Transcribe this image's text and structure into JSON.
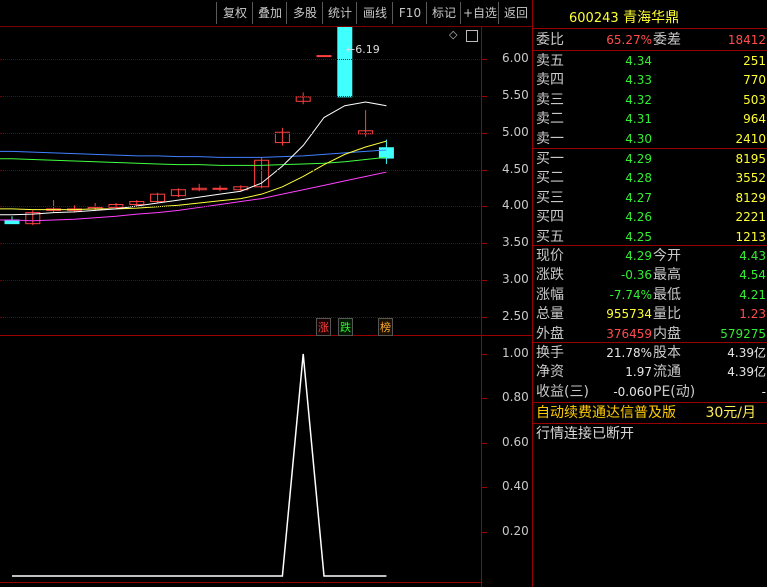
{
  "toolbar": {
    "buttons": [
      "复权",
      "叠加",
      "多股",
      "统计",
      "画线",
      "F10",
      "标记",
      "+自选",
      "返回"
    ]
  },
  "chart": {
    "price_ticks": [
      "6.00",
      "5.50",
      "5.00",
      "4.50",
      "4.00",
      "3.50",
      "3.00",
      "2.50"
    ],
    "price_axis": {
      "min": 2.5,
      "max": 6.0
    },
    "max_label": "6.19",
    "tags": [
      "涨",
      "跌",
      "榜"
    ],
    "indicator_ticks": [
      "1.00",
      "0.80",
      "0.60",
      "0.40",
      "0.20"
    ],
    "colors": {
      "up": "#ff4040",
      "down": "#40ffff",
      "ma5": "#ffffff",
      "ma10": "#ffff40",
      "ma20": "#ff40ff",
      "ma30": "#40ff40",
      "ma60": "#4080ff"
    },
    "candles": [
      {
        "o": 3.45,
        "h": 3.5,
        "l": 3.42,
        "c": 3.4
      },
      {
        "o": 3.4,
        "h": 3.58,
        "l": 3.38,
        "c": 3.55
      },
      {
        "o": 3.58,
        "h": 3.72,
        "l": 3.55,
        "c": 3.6
      },
      {
        "o": 3.58,
        "h": 3.65,
        "l": 3.55,
        "c": 3.6
      },
      {
        "o": 3.6,
        "h": 3.68,
        "l": 3.58,
        "c": 3.62
      },
      {
        "o": 3.62,
        "h": 3.68,
        "l": 3.6,
        "c": 3.66
      },
      {
        "o": 3.66,
        "h": 3.72,
        "l": 3.64,
        "c": 3.7
      },
      {
        "o": 3.7,
        "h": 3.82,
        "l": 3.68,
        "c": 3.8
      },
      {
        "o": 3.78,
        "h": 3.88,
        "l": 3.76,
        "c": 3.86
      },
      {
        "o": 3.86,
        "h": 3.94,
        "l": 3.84,
        "c": 3.88
      },
      {
        "o": 3.88,
        "h": 3.92,
        "l": 3.84,
        "c": 3.88
      },
      {
        "o": 3.86,
        "h": 3.92,
        "l": 3.84,
        "c": 3.9
      },
      {
        "o": 3.9,
        "h": 4.3,
        "l": 3.88,
        "c": 4.26
      },
      {
        "o": 4.5,
        "h": 4.7,
        "l": 4.46,
        "c": 4.64
      },
      {
        "o": 5.06,
        "h": 5.18,
        "l": 5.02,
        "c": 5.12
      },
      {
        "o": 5.68,
        "h": 5.68,
        "l": 5.68,
        "c": 5.68
      },
      {
        "o": 6.19,
        "h": 6.19,
        "l": 5.12,
        "c": 5.12
      },
      {
        "o": 4.62,
        "h": 4.94,
        "l": 4.58,
        "c": 4.66
      },
      {
        "o": 4.43,
        "h": 4.54,
        "l": 4.21,
        "c": 4.29
      }
    ],
    "ma5": [
      3.52,
      3.53,
      3.55,
      3.56,
      3.58,
      3.6,
      3.64,
      3.68,
      3.72,
      3.76,
      3.8,
      3.84,
      3.95,
      4.18,
      4.46,
      4.84,
      5.0,
      5.05,
      5.0
    ],
    "ma10": [
      3.6,
      3.59,
      3.59,
      3.59,
      3.6,
      3.6,
      3.61,
      3.63,
      3.65,
      3.68,
      3.71,
      3.74,
      3.8,
      3.9,
      4.04,
      4.2,
      4.34,
      4.44,
      4.52
    ],
    "ma20": [
      3.45,
      3.44,
      3.45,
      3.46,
      3.48,
      3.5,
      3.53,
      3.55,
      3.58,
      3.62,
      3.66,
      3.7,
      3.74,
      3.8,
      3.86,
      3.92,
      3.98,
      4.04,
      4.1
    ],
    "ma30": [
      4.28,
      4.27,
      4.26,
      4.25,
      4.24,
      4.23,
      4.22,
      4.21,
      4.2,
      4.2,
      4.19,
      4.19,
      4.19,
      4.2,
      4.21,
      4.22,
      4.24,
      4.27,
      4.3
    ],
    "ma60": [
      4.38,
      4.37,
      4.36,
      4.35,
      4.34,
      4.33,
      4.32,
      4.32,
      4.31,
      4.31,
      4.3,
      4.3,
      4.3,
      4.31,
      4.32,
      4.34,
      4.36,
      4.38,
      4.4
    ],
    "indicator": [
      0,
      0,
      0,
      0,
      0,
      0,
      0,
      0,
      0,
      0,
      0,
      0,
      0,
      0,
      1,
      0,
      0,
      0,
      0
    ]
  },
  "quote": {
    "code": "600243",
    "name": "青海华鼎",
    "weibi_label": "委比",
    "weibi_value": "65.27%",
    "weicha_label": "委差",
    "weicha_value": "18412",
    "asks": [
      {
        "label": "卖五",
        "price": "4.34",
        "vol": "251"
      },
      {
        "label": "卖四",
        "price": "4.33",
        "vol": "770"
      },
      {
        "label": "卖三",
        "price": "4.32",
        "vol": "503"
      },
      {
        "label": "卖二",
        "price": "4.31",
        "vol": "964"
      },
      {
        "label": "卖一",
        "price": "4.30",
        "vol": "2410"
      }
    ],
    "bids": [
      {
        "label": "买一",
        "price": "4.29",
        "vol": "8195"
      },
      {
        "label": "买二",
        "price": "4.28",
        "vol": "3552"
      },
      {
        "label": "买三",
        "price": "4.27",
        "vol": "8129"
      },
      {
        "label": "买四",
        "price": "4.26",
        "vol": "2221"
      },
      {
        "label": "买五",
        "price": "4.25",
        "vol": "1213"
      }
    ],
    "stats": [
      {
        "l1": "现价",
        "v1": "4.29",
        "c1": "dn",
        "l2": "今开",
        "v2": "4.43",
        "c2": "dn"
      },
      {
        "l1": "涨跌",
        "v1": "-0.36",
        "c1": "dn",
        "l2": "最高",
        "v2": "4.54",
        "c2": "dn"
      },
      {
        "l1": "涨幅",
        "v1": "-7.74%",
        "c1": "dn",
        "l2": "最低",
        "v2": "4.21",
        "c2": "dn"
      },
      {
        "l1": "总量",
        "v1": "955734",
        "c1": "yl",
        "l2": "量比",
        "v2": "1.23",
        "c2": "up"
      },
      {
        "l1": "外盘",
        "v1": "376459",
        "c1": "up",
        "l2": "内盘",
        "v2": "579275",
        "c2": "dn"
      }
    ],
    "fund": [
      {
        "l1": "换手",
        "v1": "21.78%",
        "l2": "股本",
        "v2": "4.39亿"
      },
      {
        "l1": "净资",
        "v1": "1.97",
        "l2": "流通",
        "v2": "4.39亿"
      },
      {
        "l1": "收益(三)",
        "v1": "-0.060",
        "l2": "PE(动)",
        "v2": "-"
      }
    ],
    "ad_text": "自动续费通达信普及版",
    "ad_price": "30元/月",
    "status": "行情连接已断开"
  }
}
